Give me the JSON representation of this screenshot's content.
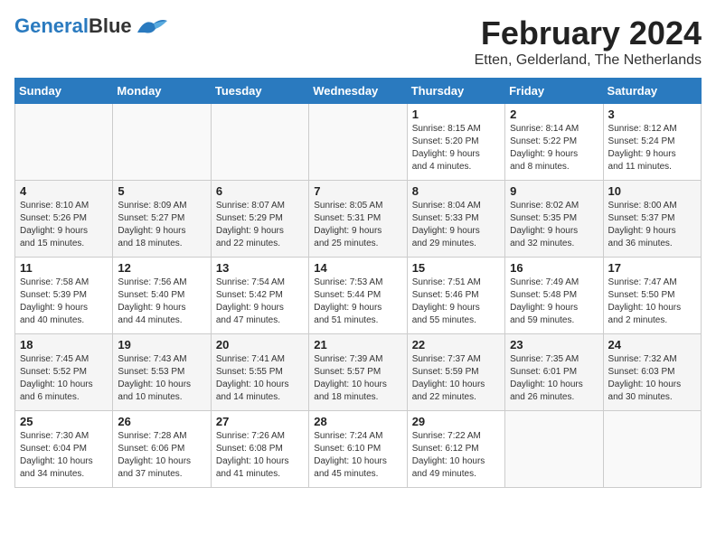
{
  "logo": {
    "part1": "General",
    "part2": "Blue"
  },
  "title": "February 2024",
  "location": "Etten, Gelderland, The Netherlands",
  "weekdays": [
    "Sunday",
    "Monday",
    "Tuesday",
    "Wednesday",
    "Thursday",
    "Friday",
    "Saturday"
  ],
  "weeks": [
    [
      {
        "day": "",
        "info": ""
      },
      {
        "day": "",
        "info": ""
      },
      {
        "day": "",
        "info": ""
      },
      {
        "day": "",
        "info": ""
      },
      {
        "day": "1",
        "info": "Sunrise: 8:15 AM\nSunset: 5:20 PM\nDaylight: 9 hours\nand 4 minutes."
      },
      {
        "day": "2",
        "info": "Sunrise: 8:14 AM\nSunset: 5:22 PM\nDaylight: 9 hours\nand 8 minutes."
      },
      {
        "day": "3",
        "info": "Sunrise: 8:12 AM\nSunset: 5:24 PM\nDaylight: 9 hours\nand 11 minutes."
      }
    ],
    [
      {
        "day": "4",
        "info": "Sunrise: 8:10 AM\nSunset: 5:26 PM\nDaylight: 9 hours\nand 15 minutes."
      },
      {
        "day": "5",
        "info": "Sunrise: 8:09 AM\nSunset: 5:27 PM\nDaylight: 9 hours\nand 18 minutes."
      },
      {
        "day": "6",
        "info": "Sunrise: 8:07 AM\nSunset: 5:29 PM\nDaylight: 9 hours\nand 22 minutes."
      },
      {
        "day": "7",
        "info": "Sunrise: 8:05 AM\nSunset: 5:31 PM\nDaylight: 9 hours\nand 25 minutes."
      },
      {
        "day": "8",
        "info": "Sunrise: 8:04 AM\nSunset: 5:33 PM\nDaylight: 9 hours\nand 29 minutes."
      },
      {
        "day": "9",
        "info": "Sunrise: 8:02 AM\nSunset: 5:35 PM\nDaylight: 9 hours\nand 32 minutes."
      },
      {
        "day": "10",
        "info": "Sunrise: 8:00 AM\nSunset: 5:37 PM\nDaylight: 9 hours\nand 36 minutes."
      }
    ],
    [
      {
        "day": "11",
        "info": "Sunrise: 7:58 AM\nSunset: 5:39 PM\nDaylight: 9 hours\nand 40 minutes."
      },
      {
        "day": "12",
        "info": "Sunrise: 7:56 AM\nSunset: 5:40 PM\nDaylight: 9 hours\nand 44 minutes."
      },
      {
        "day": "13",
        "info": "Sunrise: 7:54 AM\nSunset: 5:42 PM\nDaylight: 9 hours\nand 47 minutes."
      },
      {
        "day": "14",
        "info": "Sunrise: 7:53 AM\nSunset: 5:44 PM\nDaylight: 9 hours\nand 51 minutes."
      },
      {
        "day": "15",
        "info": "Sunrise: 7:51 AM\nSunset: 5:46 PM\nDaylight: 9 hours\nand 55 minutes."
      },
      {
        "day": "16",
        "info": "Sunrise: 7:49 AM\nSunset: 5:48 PM\nDaylight: 9 hours\nand 59 minutes."
      },
      {
        "day": "17",
        "info": "Sunrise: 7:47 AM\nSunset: 5:50 PM\nDaylight: 10 hours\nand 2 minutes."
      }
    ],
    [
      {
        "day": "18",
        "info": "Sunrise: 7:45 AM\nSunset: 5:52 PM\nDaylight: 10 hours\nand 6 minutes."
      },
      {
        "day": "19",
        "info": "Sunrise: 7:43 AM\nSunset: 5:53 PM\nDaylight: 10 hours\nand 10 minutes."
      },
      {
        "day": "20",
        "info": "Sunrise: 7:41 AM\nSunset: 5:55 PM\nDaylight: 10 hours\nand 14 minutes."
      },
      {
        "day": "21",
        "info": "Sunrise: 7:39 AM\nSunset: 5:57 PM\nDaylight: 10 hours\nand 18 minutes."
      },
      {
        "day": "22",
        "info": "Sunrise: 7:37 AM\nSunset: 5:59 PM\nDaylight: 10 hours\nand 22 minutes."
      },
      {
        "day": "23",
        "info": "Sunrise: 7:35 AM\nSunset: 6:01 PM\nDaylight: 10 hours\nand 26 minutes."
      },
      {
        "day": "24",
        "info": "Sunrise: 7:32 AM\nSunset: 6:03 PM\nDaylight: 10 hours\nand 30 minutes."
      }
    ],
    [
      {
        "day": "25",
        "info": "Sunrise: 7:30 AM\nSunset: 6:04 PM\nDaylight: 10 hours\nand 34 minutes."
      },
      {
        "day": "26",
        "info": "Sunrise: 7:28 AM\nSunset: 6:06 PM\nDaylight: 10 hours\nand 37 minutes."
      },
      {
        "day": "27",
        "info": "Sunrise: 7:26 AM\nSunset: 6:08 PM\nDaylight: 10 hours\nand 41 minutes."
      },
      {
        "day": "28",
        "info": "Sunrise: 7:24 AM\nSunset: 6:10 PM\nDaylight: 10 hours\nand 45 minutes."
      },
      {
        "day": "29",
        "info": "Sunrise: 7:22 AM\nSunset: 6:12 PM\nDaylight: 10 hours\nand 49 minutes."
      },
      {
        "day": "",
        "info": ""
      },
      {
        "day": "",
        "info": ""
      }
    ]
  ]
}
